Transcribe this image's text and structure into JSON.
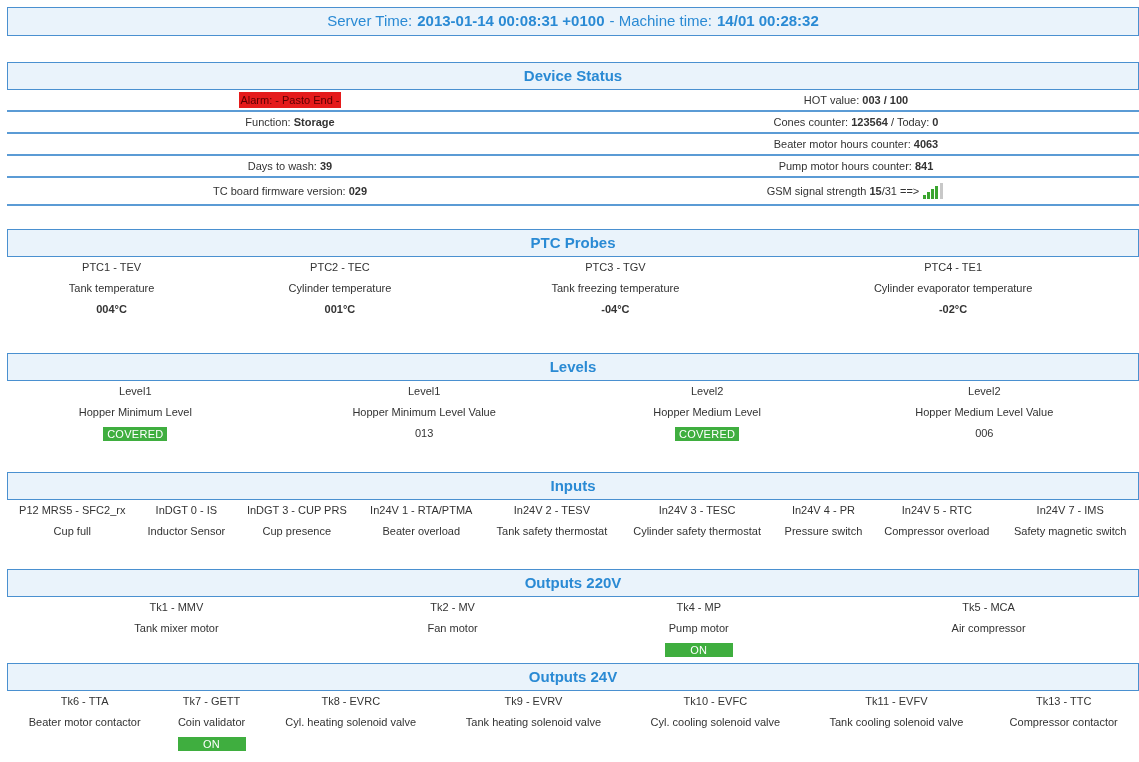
{
  "time_bar": {
    "server_label": "Server Time:",
    "server_time": "2013-01-14 00:08:31 +0100",
    "separator": "- Machine time:",
    "machine_time": "14/01 00:28:32"
  },
  "device_status": {
    "title": "Device Status",
    "rows": [
      {
        "left": {
          "kind": "alarm",
          "text": "Alarm: - Pasto End -"
        },
        "right": {
          "kind": "text",
          "text": "HOT value: **003 / 100**"
        }
      },
      {
        "left": {
          "kind": "text",
          "text": "Function: **Storage**"
        },
        "right": {
          "kind": "text",
          "text": "Cones counter: **123564** / Today: **0**"
        }
      },
      {
        "right": {
          "kind": "text",
          "text": "Beater motor hours counter: **4063**"
        }
      },
      {
        "left": {
          "kind": "text",
          "text": "Days to wash: **39**"
        },
        "right": {
          "kind": "text",
          "text": "Pump motor hours counter: **841**"
        }
      },
      {
        "left": {
          "kind": "text",
          "text": "TC board firmware version: **029**"
        },
        "right": {
          "kind": "signal",
          "text": "GSM signal strength **15**/31 ==>"
        }
      }
    ]
  },
  "sections": [
    {
      "title": "PTC Probes",
      "kind": "probes",
      "items": [
        {
          "code": "PTC1 - TEV",
          "name": "Tank temperature",
          "value": "004°C"
        },
        {
          "code": "PTC2 - TEC",
          "name": "Cylinder temperature",
          "value": "001°C"
        },
        {
          "code": "PTC3 - TGV",
          "name": "Tank freezing temperature",
          "value": "-04°C"
        },
        {
          "code": "PTC4 - TE1",
          "name": "Cylinder evaporator temperature",
          "value": "-02°C"
        }
      ]
    },
    {
      "title": "Levels",
      "kind": "levels",
      "items": [
        {
          "code": "Level1",
          "name": "Hopper Minimum Level",
          "state": "COVERED"
        },
        {
          "code": "Level1",
          "name": "Hopper Minimum Level Value",
          "value": "013"
        },
        {
          "code": "Level2",
          "name": "Hopper Medium Level",
          "state": "COVERED"
        },
        {
          "code": "Level2",
          "name": "Hopper Medium Level Value",
          "value": "006"
        }
      ]
    },
    {
      "title": "Inputs",
      "kind": "inputs",
      "items": [
        {
          "code": "P12 MRS5 - SFC2_rx",
          "name": "Cup full"
        },
        {
          "code": "InDGT 0 - IS",
          "name": "Inductor Sensor"
        },
        {
          "code": "InDGT 3 - CUP PRS",
          "name": "Cup presence"
        },
        {
          "code": "In24V 1 - RTA/PTMA",
          "name": "Beater overload"
        },
        {
          "code": "In24V 2 - TESV",
          "name": "Tank safety thermostat"
        },
        {
          "code": "In24V 3 - TESC",
          "name": "Cylinder safety thermostat"
        },
        {
          "code": "In24V 4 - PR",
          "name": "Pressure switch"
        },
        {
          "code": "In24V 5 - RTC",
          "name": "Compressor overload"
        },
        {
          "code": "In24V 7 - IMS",
          "name": "Safety magnetic switch"
        }
      ]
    },
    {
      "title": "Outputs 220V",
      "kind": "outputs",
      "items": [
        {
          "code": "Tk1 - MMV",
          "name": "Tank mixer motor"
        },
        {
          "code": "Tk2 - MV",
          "name": "Fan motor"
        },
        {
          "code": "Tk4 - MP",
          "name": "Pump motor",
          "state": "ON"
        },
        {
          "code": "Tk5 - MCA",
          "name": "Air compressor"
        }
      ]
    },
    {
      "title": "Outputs 24V",
      "kind": "outputs",
      "items": [
        {
          "code": "Tk6 - TTA",
          "name": "Beater motor contactor"
        },
        {
          "code": "Tk7 - GETT",
          "name": "Coin validator",
          "state": "ON"
        },
        {
          "code": "Tk8 - EVRC",
          "name": "Cyl. heating solenoid valve"
        },
        {
          "code": "Tk9 - EVRV",
          "name": "Tank heating solenoid valve"
        },
        {
          "code": "Tk10 - EVFC",
          "name": "Cyl. cooling solenoid valve"
        },
        {
          "code": "Tk11 - EVFV",
          "name": "Tank cooling solenoid valve"
        },
        {
          "code": "Tk13 - TTC",
          "name": "Compressor contactor"
        }
      ]
    }
  ]
}
